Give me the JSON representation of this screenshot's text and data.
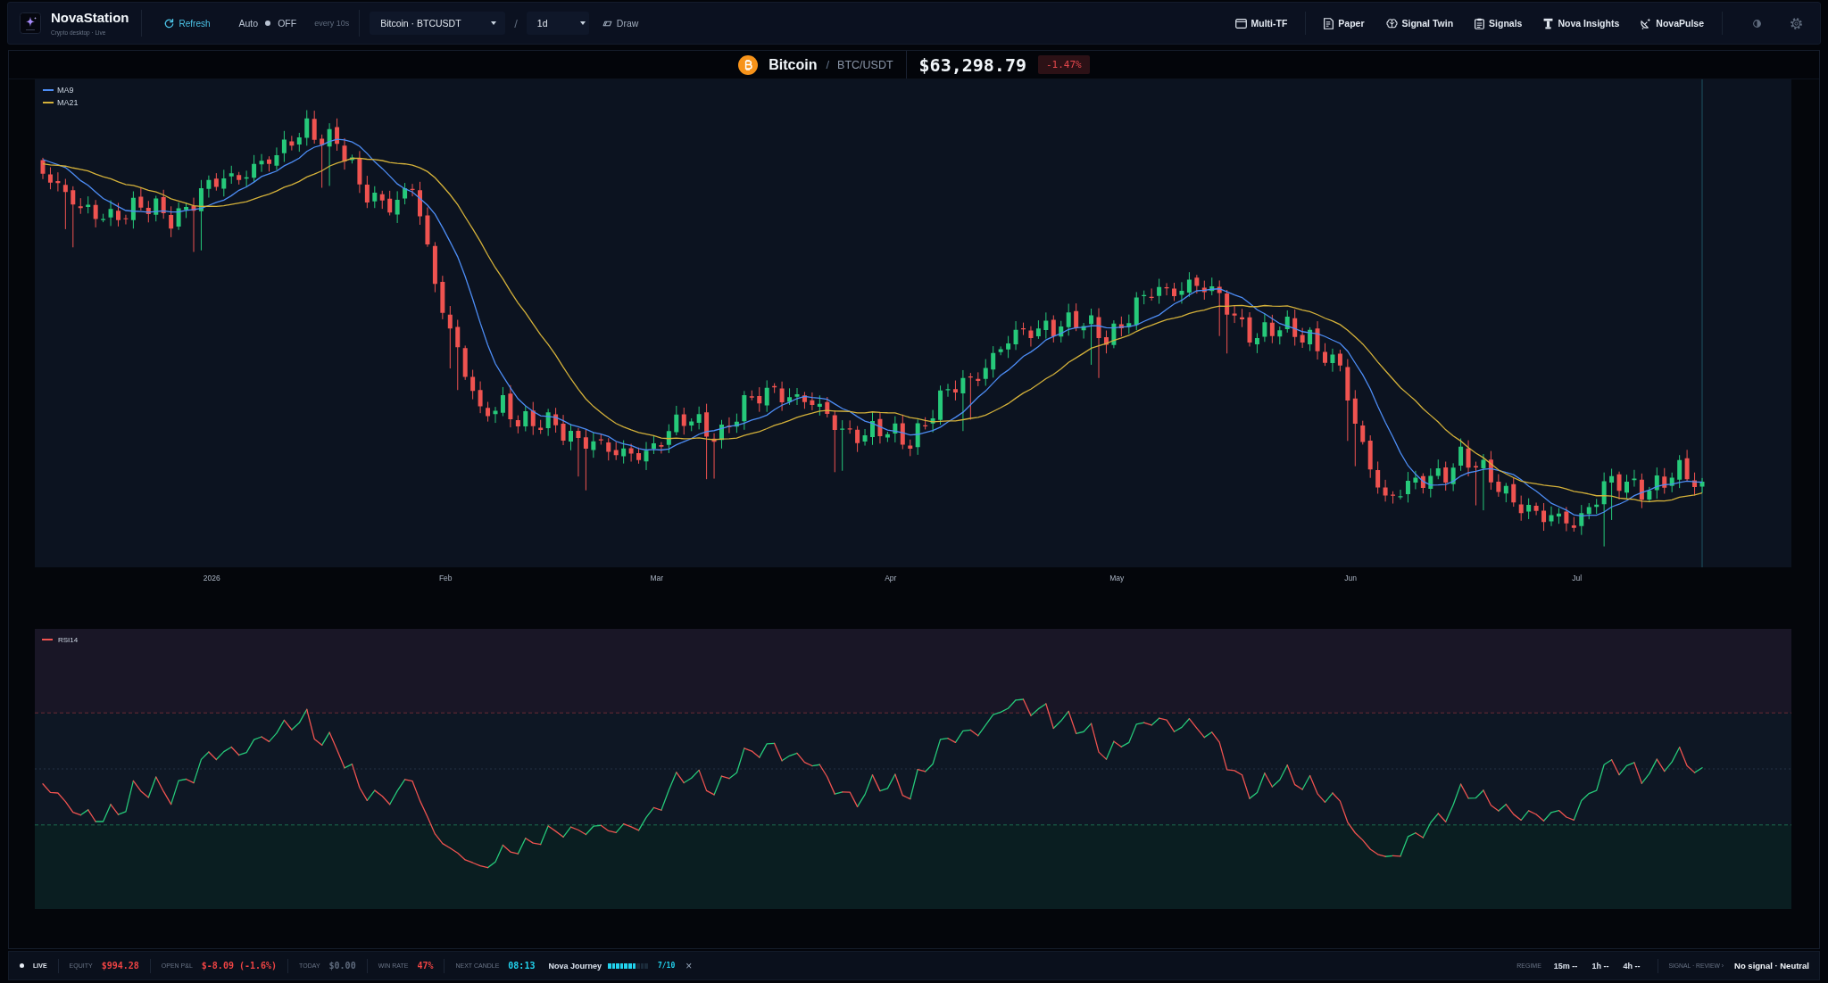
{
  "app": {
    "name": "NovaStation",
    "subtitle": "Crypto desktop · Live"
  },
  "toolbar": {
    "refresh": "Refresh",
    "auto": {
      "label": "Auto",
      "on": false,
      "state": "OFF"
    },
    "interval": "every 10s",
    "symbol_select": "Bitcoin · BTCUSDT",
    "separator": "/",
    "timeframe_select": "1d",
    "draw": "Draw"
  },
  "nav_groups": [
    [
      "Multi-TF"
    ],
    [
      "Paper",
      "Signal Twin",
      "Signals",
      "Nova Insights",
      "NovaPulse"
    ]
  ],
  "chart_header": {
    "name": "Bitcoin",
    "separator": "/",
    "pair": "BTC/USDT",
    "price": "$63,298.79",
    "change": "-1.47%",
    "falling": true
  },
  "price_chart": {
    "legend": [
      {
        "label": "MA9",
        "color": "#4d8df5"
      },
      {
        "label": "MA21",
        "color": "#d4b13a"
      }
    ],
    "x_labels": [
      "2026",
      "Feb",
      "Mar",
      "Apr",
      "May",
      "Jun",
      "Jul"
    ]
  },
  "rsi_chart": {
    "legend": [
      {
        "label": "RSI14",
        "color": "#ef5350"
      }
    ]
  },
  "status_bar": {
    "live": {
      "label": "LIVE",
      "on": true
    },
    "metrics": [
      {
        "label": "EQUITY",
        "value": "$994.28",
        "color": "#ef4444"
      },
      {
        "label": "OPEN P&L",
        "value": "$-8.09 (-1.6%)",
        "color": "#ef4444"
      },
      {
        "label": "TODAY",
        "value": "$0.00",
        "color": "#5f6b7d"
      },
      {
        "label": "WIN RATE",
        "value": "47%",
        "color": "#ef4444"
      },
      {
        "label": "NEXT CANDLE",
        "value": "08:13",
        "color": "#22d3ee"
      }
    ],
    "journey": {
      "label": "Nova Journey",
      "level": 0.7,
      "progress": "7/10",
      "dismiss": "×"
    },
    "regime": {
      "label": "REGIME",
      "timeframes": [
        "15m --",
        "1h --",
        "4h --"
      ]
    },
    "signal": {
      "label": "SIGNAL · REVIEW ›",
      "value": "No signal · Neutral"
    }
  }
}
